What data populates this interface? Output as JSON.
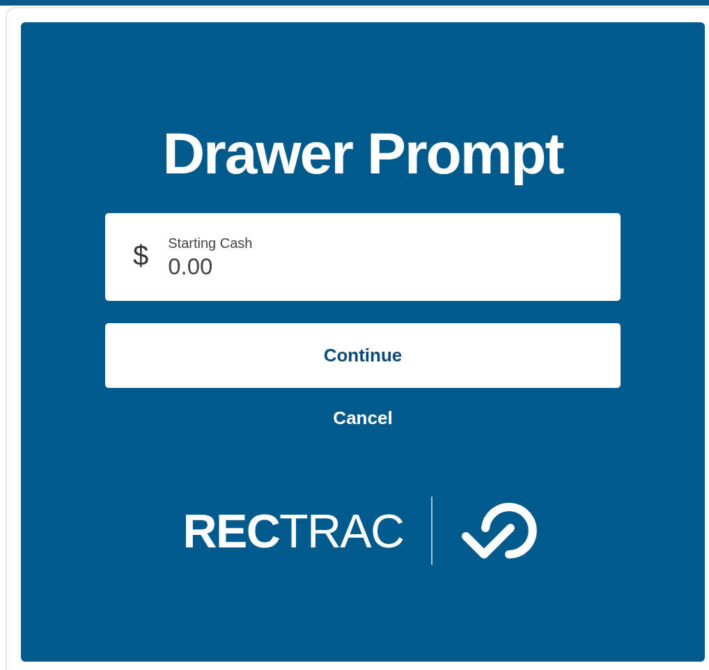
{
  "dialog": {
    "title": "Drawer Prompt"
  },
  "field": {
    "prefix": "$",
    "label": "Starting Cash",
    "value": "0.00"
  },
  "buttons": [
    {
      "kind": "primary",
      "label": "Continue"
    },
    {
      "kind": "link",
      "label": "Cancel"
    }
  ],
  "logo": {
    "text": "**REC**TRAC"
  }
}
